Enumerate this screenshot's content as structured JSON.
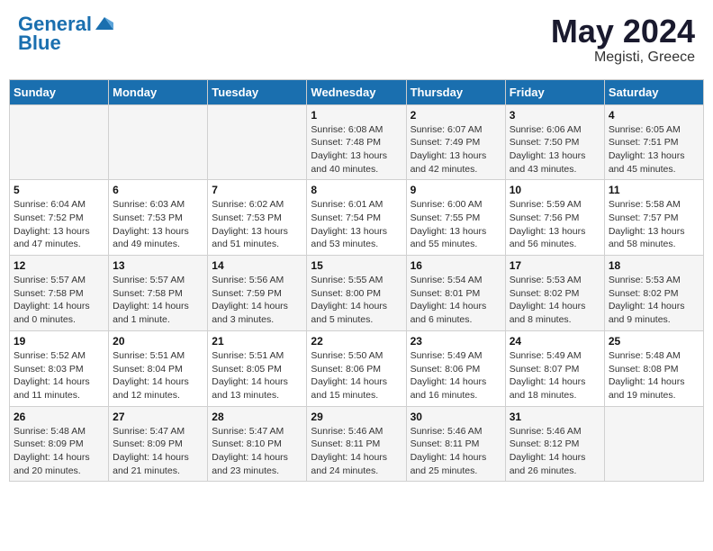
{
  "header": {
    "logo_line1": "General",
    "logo_line2": "Blue",
    "month_year": "May 2024",
    "location": "Megisti, Greece"
  },
  "calendar": {
    "days_of_week": [
      "Sunday",
      "Monday",
      "Tuesday",
      "Wednesday",
      "Thursday",
      "Friday",
      "Saturday"
    ],
    "weeks": [
      [
        {
          "day": "",
          "detail": ""
        },
        {
          "day": "",
          "detail": ""
        },
        {
          "day": "",
          "detail": ""
        },
        {
          "day": "1",
          "detail": "Sunrise: 6:08 AM\nSunset: 7:48 PM\nDaylight: 13 hours\nand 40 minutes."
        },
        {
          "day": "2",
          "detail": "Sunrise: 6:07 AM\nSunset: 7:49 PM\nDaylight: 13 hours\nand 42 minutes."
        },
        {
          "day": "3",
          "detail": "Sunrise: 6:06 AM\nSunset: 7:50 PM\nDaylight: 13 hours\nand 43 minutes."
        },
        {
          "day": "4",
          "detail": "Sunrise: 6:05 AM\nSunset: 7:51 PM\nDaylight: 13 hours\nand 45 minutes."
        }
      ],
      [
        {
          "day": "5",
          "detail": "Sunrise: 6:04 AM\nSunset: 7:52 PM\nDaylight: 13 hours\nand 47 minutes."
        },
        {
          "day": "6",
          "detail": "Sunrise: 6:03 AM\nSunset: 7:53 PM\nDaylight: 13 hours\nand 49 minutes."
        },
        {
          "day": "7",
          "detail": "Sunrise: 6:02 AM\nSunset: 7:53 PM\nDaylight: 13 hours\nand 51 minutes."
        },
        {
          "day": "8",
          "detail": "Sunrise: 6:01 AM\nSunset: 7:54 PM\nDaylight: 13 hours\nand 53 minutes."
        },
        {
          "day": "9",
          "detail": "Sunrise: 6:00 AM\nSunset: 7:55 PM\nDaylight: 13 hours\nand 55 minutes."
        },
        {
          "day": "10",
          "detail": "Sunrise: 5:59 AM\nSunset: 7:56 PM\nDaylight: 13 hours\nand 56 minutes."
        },
        {
          "day": "11",
          "detail": "Sunrise: 5:58 AM\nSunset: 7:57 PM\nDaylight: 13 hours\nand 58 minutes."
        }
      ],
      [
        {
          "day": "12",
          "detail": "Sunrise: 5:57 AM\nSunset: 7:58 PM\nDaylight: 14 hours\nand 0 minutes."
        },
        {
          "day": "13",
          "detail": "Sunrise: 5:57 AM\nSunset: 7:58 PM\nDaylight: 14 hours\nand 1 minute."
        },
        {
          "day": "14",
          "detail": "Sunrise: 5:56 AM\nSunset: 7:59 PM\nDaylight: 14 hours\nand 3 minutes."
        },
        {
          "day": "15",
          "detail": "Sunrise: 5:55 AM\nSunset: 8:00 PM\nDaylight: 14 hours\nand 5 minutes."
        },
        {
          "day": "16",
          "detail": "Sunrise: 5:54 AM\nSunset: 8:01 PM\nDaylight: 14 hours\nand 6 minutes."
        },
        {
          "day": "17",
          "detail": "Sunrise: 5:53 AM\nSunset: 8:02 PM\nDaylight: 14 hours\nand 8 minutes."
        },
        {
          "day": "18",
          "detail": "Sunrise: 5:53 AM\nSunset: 8:02 PM\nDaylight: 14 hours\nand 9 minutes."
        }
      ],
      [
        {
          "day": "19",
          "detail": "Sunrise: 5:52 AM\nSunset: 8:03 PM\nDaylight: 14 hours\nand 11 minutes."
        },
        {
          "day": "20",
          "detail": "Sunrise: 5:51 AM\nSunset: 8:04 PM\nDaylight: 14 hours\nand 12 minutes."
        },
        {
          "day": "21",
          "detail": "Sunrise: 5:51 AM\nSunset: 8:05 PM\nDaylight: 14 hours\nand 13 minutes."
        },
        {
          "day": "22",
          "detail": "Sunrise: 5:50 AM\nSunset: 8:06 PM\nDaylight: 14 hours\nand 15 minutes."
        },
        {
          "day": "23",
          "detail": "Sunrise: 5:49 AM\nSunset: 8:06 PM\nDaylight: 14 hours\nand 16 minutes."
        },
        {
          "day": "24",
          "detail": "Sunrise: 5:49 AM\nSunset: 8:07 PM\nDaylight: 14 hours\nand 18 minutes."
        },
        {
          "day": "25",
          "detail": "Sunrise: 5:48 AM\nSunset: 8:08 PM\nDaylight: 14 hours\nand 19 minutes."
        }
      ],
      [
        {
          "day": "26",
          "detail": "Sunrise: 5:48 AM\nSunset: 8:09 PM\nDaylight: 14 hours\nand 20 minutes."
        },
        {
          "day": "27",
          "detail": "Sunrise: 5:47 AM\nSunset: 8:09 PM\nDaylight: 14 hours\nand 21 minutes."
        },
        {
          "day": "28",
          "detail": "Sunrise: 5:47 AM\nSunset: 8:10 PM\nDaylight: 14 hours\nand 23 minutes."
        },
        {
          "day": "29",
          "detail": "Sunrise: 5:46 AM\nSunset: 8:11 PM\nDaylight: 14 hours\nand 24 minutes."
        },
        {
          "day": "30",
          "detail": "Sunrise: 5:46 AM\nSunset: 8:11 PM\nDaylight: 14 hours\nand 25 minutes."
        },
        {
          "day": "31",
          "detail": "Sunrise: 5:46 AM\nSunset: 8:12 PM\nDaylight: 14 hours\nand 26 minutes."
        },
        {
          "day": "",
          "detail": ""
        }
      ]
    ]
  }
}
